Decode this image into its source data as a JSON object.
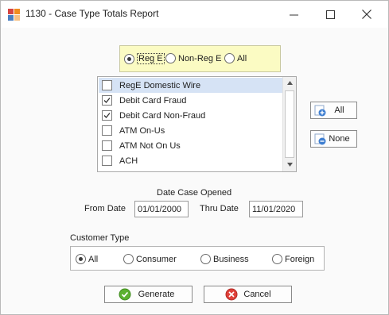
{
  "window": {
    "title": "1130 - Case Type Totals Report",
    "icon": "app-grid-icon",
    "colors": {
      "icon_orange": "#f08c1e",
      "icon_red": "#d64541",
      "icon_blue": "#4a7fc1"
    }
  },
  "filter": {
    "options": [
      "Reg E",
      "Non-Reg E",
      "All"
    ],
    "selected": "Reg E",
    "background": "#fbfbc3"
  },
  "case_types": [
    {
      "label": "RegE Domestic Wire",
      "checked": false,
      "highlighted": true
    },
    {
      "label": "Debit Card Fraud",
      "checked": true
    },
    {
      "label": "Debit Card Non-Fraud",
      "checked": true
    },
    {
      "label": "ATM On-Us",
      "checked": false
    },
    {
      "label": "ATM Not On Us",
      "checked": false
    },
    {
      "label": "ACH",
      "checked": false
    }
  ],
  "buttons": {
    "all": "All",
    "none": "None",
    "generate": "Generate",
    "cancel": "Cancel"
  },
  "dates": {
    "heading": "Date Case Opened",
    "from_label": "From Date",
    "from_value": "01/01/2000",
    "thru_label": "Thru Date",
    "thru_value": "11/01/2020"
  },
  "customer_type": {
    "label": "Customer Type",
    "options": [
      "All",
      "Consumer",
      "Business",
      "Foreign"
    ],
    "selected": "All"
  }
}
